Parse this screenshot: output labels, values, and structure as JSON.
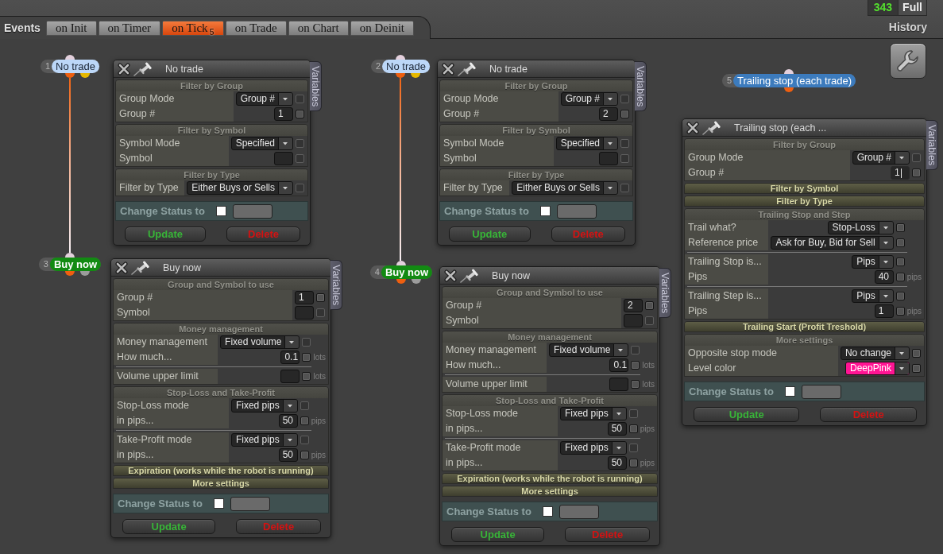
{
  "header": {
    "events_label": "Events",
    "tabs": [
      {
        "label": "on Init",
        "selected": false
      },
      {
        "label": "on Timer",
        "selected": false
      },
      {
        "label": "on Tick",
        "selected": true,
        "badge": "5"
      },
      {
        "label": "on Trade",
        "selected": false
      },
      {
        "label": "on Chart",
        "selected": false
      },
      {
        "label": "on Deinit",
        "selected": false
      }
    ],
    "counter": "343",
    "mode_button": "Full",
    "history_button": "History"
  },
  "flows": [
    {
      "nodes": [
        {
          "number": "1",
          "label": "No trade",
          "kind": "filter",
          "color": "#bcd7f8",
          "outputs": [
            {
              "color": "#ee5f10"
            },
            {
              "color": "#e6b800"
            }
          ],
          "panel": {
            "title": "No trade",
            "side_tab": "Variables",
            "sections": [
              {
                "title": "Filter by Group",
                "expanded": true,
                "groups": [
                  [
                    {
                      "label": "Group Mode",
                      "control": {
                        "kind": "select",
                        "value": "Group #"
                      },
                      "checkbox": {
                        "checked": false,
                        "disabled": true
                      }
                    },
                    {
                      "label": "Group #",
                      "control": {
                        "kind": "input",
                        "value": "1",
                        "focused": false
                      },
                      "checkbox": {
                        "checked": false,
                        "disabled": false
                      }
                    }
                  ]
                ]
              },
              {
                "title": "Filter by Symbol",
                "expanded": true,
                "groups": [
                  [
                    {
                      "label": "Symbol Mode",
                      "control": {
                        "kind": "select",
                        "value": "Specified"
                      },
                      "checkbox": {
                        "checked": false,
                        "disabled": true
                      }
                    },
                    {
                      "label": "Symbol",
                      "control": {
                        "kind": "input",
                        "focused": false
                      },
                      "checkbox": {
                        "checked": false,
                        "disabled": true
                      }
                    }
                  ]
                ]
              },
              {
                "title": "Filter by Type",
                "expanded": true,
                "groups": [
                  [
                    {
                      "label": "Filter by Type",
                      "control": {
                        "kind": "select",
                        "value": "Either Buys or Sells"
                      },
                      "checkbox": {
                        "checked": false,
                        "disabled": true
                      }
                    }
                  ]
                ]
              }
            ],
            "status": {
              "label": "Change Status to",
              "checked": false
            },
            "buttons": [
              {
                "label": "Update",
                "kind": "update"
              },
              {
                "label": "Delete",
                "kind": "delete"
              }
            ]
          }
        },
        {
          "number": "3",
          "label": "Buy now",
          "kind": "order",
          "color": "#128a12",
          "outputs": [
            {
              "color": "#ee5f10"
            },
            {
              "color": "#9c9c9c"
            }
          ],
          "panel": {
            "title": "Buy now",
            "side_tab": "Variables",
            "sections": [
              {
                "title": "Group and Symbol to use",
                "expanded": true,
                "groups": [
                  [
                    {
                      "label": "Group #",
                      "control": {
                        "kind": "input",
                        "value": "1",
                        "focused": false
                      },
                      "checkbox": {
                        "checked": false,
                        "disabled": false
                      }
                    },
                    {
                      "label": "Symbol",
                      "control": {
                        "kind": "input",
                        "focused": false
                      },
                      "checkbox": {
                        "checked": false,
                        "disabled": true
                      }
                    }
                  ]
                ]
              },
              {
                "title": "Money management",
                "expanded": true,
                "groups": [
                  [
                    {
                      "label": "Money management",
                      "control": {
                        "kind": "select",
                        "value": "Fixed volume"
                      },
                      "checkbox": {
                        "checked": false,
                        "disabled": true
                      }
                    },
                    {
                      "label": "How much...",
                      "control": {
                        "kind": "input",
                        "value": "0.1",
                        "focused": false
                      },
                      "checkbox": {
                        "checked": false,
                        "disabled": false
                      },
                      "unit": "lots"
                    }
                  ],
                  [
                    {
                      "label": "Volume upper limit",
                      "control": {
                        "kind": "input",
                        "focused": false
                      },
                      "checkbox": {
                        "checked": false,
                        "disabled": false
                      },
                      "unit": "lots"
                    }
                  ]
                ]
              },
              {
                "title": "Stop-Loss and Take-Profit",
                "expanded": true,
                "groups": [
                  [
                    {
                      "label": "Stop-Loss mode",
                      "control": {
                        "kind": "select",
                        "value": "Fixed pips"
                      },
                      "checkbox": {
                        "checked": false,
                        "disabled": true
                      }
                    },
                    {
                      "label": "in pips...",
                      "control": {
                        "kind": "input",
                        "value": "50",
                        "focused": false
                      },
                      "checkbox": {
                        "checked": false,
                        "disabled": false
                      },
                      "unit": "pips"
                    }
                  ],
                  [
                    {
                      "label": "Take-Profit mode",
                      "control": {
                        "kind": "select",
                        "value": "Fixed pips"
                      },
                      "checkbox": {
                        "checked": false,
                        "disabled": true
                      }
                    },
                    {
                      "label": "in pips...",
                      "control": {
                        "kind": "input",
                        "value": "50",
                        "focused": false
                      },
                      "checkbox": {
                        "checked": false,
                        "disabled": false
                      },
                      "unit": "pips"
                    }
                  ]
                ]
              },
              {
                "title": "Expiration (works while the robot is running)",
                "expanded": false
              },
              {
                "title": "More settings",
                "expanded": false
              }
            ],
            "status": {
              "label": "Change Status to",
              "checked": false
            },
            "buttons": [
              {
                "label": "Update",
                "kind": "update"
              },
              {
                "label": "Delete",
                "kind": "delete"
              }
            ]
          }
        }
      ]
    },
    {
      "nodes": [
        {
          "number": "2",
          "label": "No trade",
          "kind": "filter",
          "color": "#bcd7f8",
          "outputs": [
            {
              "color": "#ee5f10"
            },
            {
              "color": "#e6b800"
            }
          ],
          "panel": {
            "title": "No trade",
            "side_tab": "Variables",
            "sections": [
              {
                "title": "Filter by Group",
                "expanded": true,
                "groups": [
                  [
                    {
                      "label": "Group Mode",
                      "control": {
                        "kind": "select",
                        "value": "Group #"
                      },
                      "checkbox": {
                        "checked": false,
                        "disabled": true
                      }
                    },
                    {
                      "label": "Group #",
                      "control": {
                        "kind": "input",
                        "value": "2",
                        "focused": false
                      },
                      "checkbox": {
                        "checked": false,
                        "disabled": false
                      }
                    }
                  ]
                ]
              },
              {
                "title": "Filter by Symbol",
                "expanded": true,
                "groups": [
                  [
                    {
                      "label": "Symbol Mode",
                      "control": {
                        "kind": "select",
                        "value": "Specified"
                      },
                      "checkbox": {
                        "checked": false,
                        "disabled": true
                      }
                    },
                    {
                      "label": "Symbol",
                      "control": {
                        "kind": "input",
                        "focused": false
                      },
                      "checkbox": {
                        "checked": false,
                        "disabled": true
                      }
                    }
                  ]
                ]
              },
              {
                "title": "Filter by Type",
                "expanded": true,
                "groups": [
                  [
                    {
                      "label": "Filter by Type",
                      "control": {
                        "kind": "select",
                        "value": "Either Buys or Sells"
                      },
                      "checkbox": {
                        "checked": false,
                        "disabled": true
                      }
                    }
                  ]
                ]
              }
            ],
            "status": {
              "label": "Change Status to",
              "checked": false
            },
            "buttons": [
              {
                "label": "Update",
                "kind": "update"
              },
              {
                "label": "Delete",
                "kind": "delete"
              }
            ]
          }
        },
        {
          "number": "4",
          "label": "Buy now",
          "kind": "order",
          "color": "#128a12",
          "outputs": [
            {
              "color": "#ee5f10"
            },
            {
              "color": "#9c9c9c"
            }
          ],
          "panel": {
            "title": "Buy now",
            "side_tab": "Variables",
            "sections": [
              {
                "title": "Group and Symbol to use",
                "expanded": true,
                "groups": [
                  [
                    {
                      "label": "Group #",
                      "control": {
                        "kind": "input",
                        "value": "2",
                        "focused": false
                      },
                      "checkbox": {
                        "checked": false,
                        "disabled": false
                      }
                    },
                    {
                      "label": "Symbol",
                      "control": {
                        "kind": "input",
                        "focused": false
                      },
                      "checkbox": {
                        "checked": false,
                        "disabled": true
                      }
                    }
                  ]
                ]
              },
              {
                "title": "Money management",
                "expanded": true,
                "groups": [
                  [
                    {
                      "label": "Money management",
                      "control": {
                        "kind": "select",
                        "value": "Fixed volume"
                      },
                      "checkbox": {
                        "checked": false,
                        "disabled": true
                      }
                    },
                    {
                      "label": "How much...",
                      "control": {
                        "kind": "input",
                        "value": "0.1",
                        "focused": false
                      },
                      "checkbox": {
                        "checked": false,
                        "disabled": false
                      },
                      "unit": "lots"
                    }
                  ],
                  [
                    {
                      "label": "Volume upper limit",
                      "control": {
                        "kind": "input",
                        "focused": false
                      },
                      "checkbox": {
                        "checked": false,
                        "disabled": false
                      },
                      "unit": "lots"
                    }
                  ]
                ]
              },
              {
                "title": "Stop-Loss and Take-Profit",
                "expanded": true,
                "groups": [
                  [
                    {
                      "label": "Stop-Loss mode",
                      "control": {
                        "kind": "select",
                        "value": "Fixed pips"
                      },
                      "checkbox": {
                        "checked": false,
                        "disabled": true
                      }
                    },
                    {
                      "label": "in pips...",
                      "control": {
                        "kind": "input",
                        "value": "50",
                        "focused": false
                      },
                      "checkbox": {
                        "checked": false,
                        "disabled": false
                      },
                      "unit": "pips"
                    }
                  ],
                  [
                    {
                      "label": "Take-Profit mode",
                      "control": {
                        "kind": "select",
                        "value": "Fixed pips"
                      },
                      "checkbox": {
                        "checked": false,
                        "disabled": true
                      }
                    },
                    {
                      "label": "in pips...",
                      "control": {
                        "kind": "input",
                        "value": "50",
                        "focused": false
                      },
                      "checkbox": {
                        "checked": false,
                        "disabled": false
                      },
                      "unit": "pips"
                    }
                  ]
                ]
              },
              {
                "title": "Expiration (works while the robot is running)",
                "expanded": false
              },
              {
                "title": "More settings",
                "expanded": false
              }
            ],
            "status": {
              "label": "Change Status to",
              "checked": false
            },
            "buttons": [
              {
                "label": "Update",
                "kind": "update"
              },
              {
                "label": "Delete",
                "kind": "delete"
              }
            ]
          }
        }
      ]
    },
    {
      "nodes": [
        {
          "number": "5",
          "label": "Trailing stop (each trade)",
          "kind": "modifier",
          "color": "#3c7bbd",
          "outputs": [
            {
              "color": "#ee5f10"
            }
          ],
          "panel": {
            "title": "Trailing stop (each ...",
            "side_tab": "Variables",
            "sections": [
              {
                "title": "Filter by Group",
                "expanded": true,
                "groups": [
                  [
                    {
                      "label": "Group Mode",
                      "control": {
                        "kind": "select",
                        "value": "Group #"
                      },
                      "checkbox": {
                        "checked": false,
                        "disabled": true
                      }
                    },
                    {
                      "label": "Group #",
                      "control": {
                        "kind": "input",
                        "value": "1",
                        "focused": true
                      },
                      "checkbox": {
                        "checked": false,
                        "disabled": false
                      }
                    }
                  ]
                ]
              },
              {
                "title": "Filter by Symbol",
                "expanded": false
              },
              {
                "title": "Filter by Type",
                "expanded": false
              },
              {
                "title": "Trailing Stop and Step",
                "expanded": true,
                "groups": [
                  [
                    {
                      "label": "Trail what?",
                      "control": {
                        "kind": "select",
                        "value": "Stop-Loss"
                      },
                      "checkbox": {
                        "checked": false,
                        "disabled": false
                      }
                    },
                    {
                      "label": "Reference price",
                      "control": {
                        "kind": "select",
                        "value": "Ask for Buy, Bid for Sell"
                      },
                      "checkbox": {
                        "checked": false,
                        "disabled": false
                      }
                    }
                  ],
                  [
                    {
                      "label": "Trailing Stop is...",
                      "control": {
                        "kind": "select",
                        "value": "Pips"
                      },
                      "checkbox": {
                        "checked": false,
                        "disabled": false
                      }
                    },
                    {
                      "label": "Pips",
                      "control": {
                        "kind": "input",
                        "value": "40",
                        "focused": false
                      },
                      "checkbox": {
                        "checked": false,
                        "disabled": false
                      },
                      "unit": "pips"
                    }
                  ],
                  [
                    {
                      "label": "Trailing Step is...",
                      "control": {
                        "kind": "select",
                        "value": "Pips"
                      },
                      "checkbox": {
                        "checked": false,
                        "disabled": false
                      }
                    },
                    {
                      "label": "Pips",
                      "control": {
                        "kind": "input",
                        "value": "1",
                        "focused": false
                      },
                      "checkbox": {
                        "checked": false,
                        "disabled": false
                      },
                      "unit": "pips"
                    }
                  ]
                ]
              },
              {
                "title": "Trailing Start (Profit Treshold)",
                "expanded": false
              },
              {
                "title": "More settings",
                "expanded": true,
                "groups": [
                  [
                    {
                      "label": "Opposite stop mode",
                      "control": {
                        "kind": "select",
                        "value": "No change"
                      },
                      "checkbox": {
                        "checked": false,
                        "disabled": false
                      }
                    },
                    {
                      "label": "Level color",
                      "control": {
                        "kind": "select",
                        "value": "DeepPink",
                        "color": "#ff1493"
                      },
                      "checkbox": {
                        "checked": false,
                        "disabled": false
                      }
                    }
                  ]
                ]
              }
            ],
            "status": {
              "label": "Change Status to",
              "checked": false
            },
            "buttons": [
              {
                "label": "Update",
                "kind": "update"
              },
              {
                "label": "Delete",
                "kind": "delete"
              }
            ]
          }
        }
      ]
    }
  ]
}
